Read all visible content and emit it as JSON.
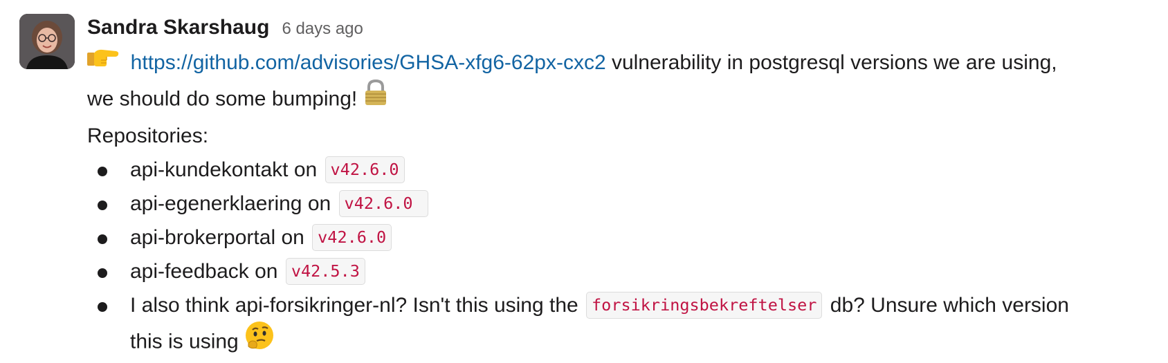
{
  "message": {
    "author": "Sandra Skarshaug",
    "timestamp": "6 days ago",
    "intro_emoji": "point-right-icon",
    "link_text": "https://github.com/advisories/GHSA-xfg6-62px-cxc2",
    "text_after_link": " vulnerability in postgresql versions we are using,",
    "text_line2": "we should do some bumping! ",
    "lock_emoji": "lock-icon",
    "repositories_label": "Repositories:",
    "repos": [
      {
        "name": "api-kundekontakt on ",
        "version": "v42.6.0"
      },
      {
        "name": "api-egenerklaering on ",
        "version": "v42.6.0 "
      },
      {
        "name": "api-brokerportal on ",
        "version": "v42.6.0"
      },
      {
        "name": "api-feedback on ",
        "version": "v42.5.3"
      }
    ],
    "last_item": {
      "before_code": "I also think api-forsikringer-nl? Isn't this using the ",
      "code": "forsikringsbekreftelser",
      "after_code": " db? Unsure which version",
      "line2": "this is using ",
      "emoji": "thinking-face-icon"
    }
  },
  "colors": {
    "link": "#1264a3",
    "code_text": "#c01343",
    "timestamp": "#616061",
    "text": "#1d1c1d"
  }
}
